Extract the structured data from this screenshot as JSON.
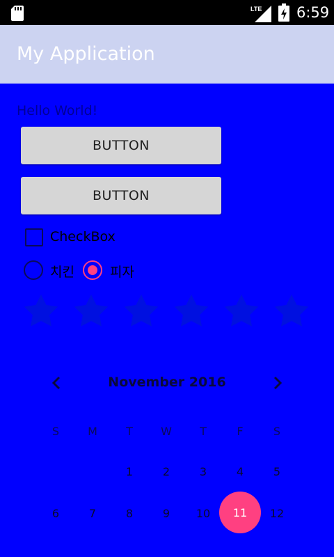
{
  "status_bar": {
    "time": "6:59",
    "network": "LTE",
    "icons": [
      "sd-card-icon",
      "lte-signal-icon",
      "battery-charging-icon"
    ]
  },
  "app_bar": {
    "title": "My Application",
    "color": "#ccd3f1"
  },
  "content": {
    "background": "#0000ff",
    "hello_text": "Hello World!",
    "button1_label": "BUTTON",
    "button2_label": "BUTTON",
    "checkbox": {
      "label": "CheckBox",
      "checked": false
    },
    "radios": [
      {
        "label": "치킨",
        "selected": false
      },
      {
        "label": "피자",
        "selected": true
      }
    ],
    "rating": {
      "max": 6,
      "value": 0
    },
    "accent_color": "#ff4081"
  },
  "calendar": {
    "month_label": "November 2016",
    "weekdays": [
      "S",
      "M",
      "T",
      "W",
      "T",
      "F",
      "S"
    ],
    "week1": [
      "",
      "",
      "1",
      "2",
      "3",
      "4",
      "5"
    ],
    "week2": [
      "6",
      "7",
      "8",
      "9",
      "10",
      "11",
      "12"
    ],
    "selected_day": "11"
  }
}
